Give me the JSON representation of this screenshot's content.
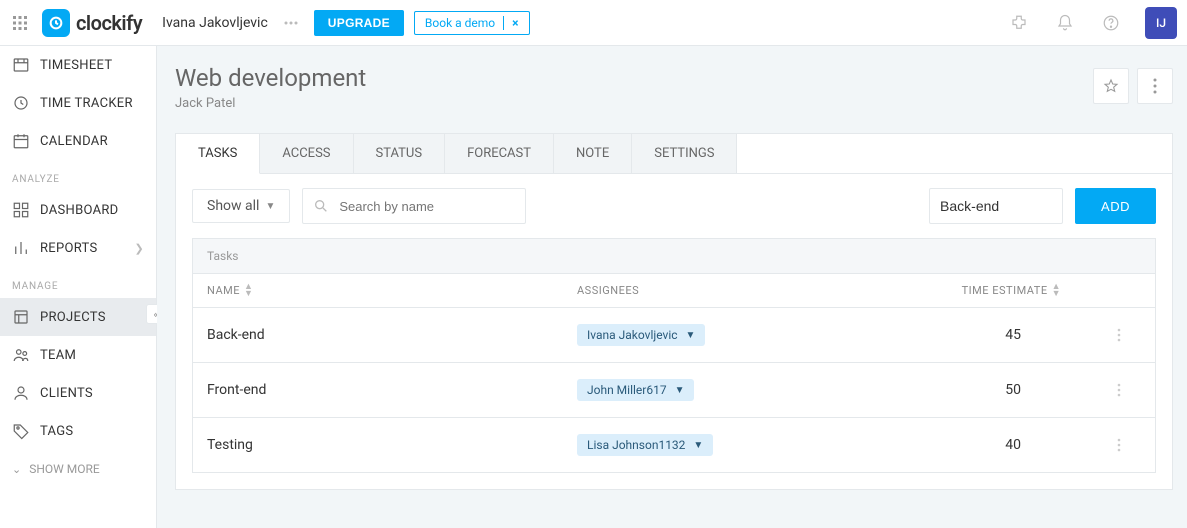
{
  "top": {
    "brand": "clockify",
    "user_display": "Ivana Jakovljevic",
    "upgrade": "UPGRADE",
    "book_demo": "Book a demo",
    "avatar_initials": "IJ"
  },
  "sidebar": {
    "items_primary": [
      {
        "label": "TIMESHEET"
      },
      {
        "label": "TIME TRACKER"
      },
      {
        "label": "CALENDAR"
      }
    ],
    "section_analyze": "ANALYZE",
    "items_analyze": [
      {
        "label": "DASHBOARD"
      },
      {
        "label": "REPORTS",
        "chevron": true
      }
    ],
    "section_manage": "MANAGE",
    "items_manage": [
      {
        "label": "PROJECTS",
        "active": true
      },
      {
        "label": "TEAM"
      },
      {
        "label": "CLIENTS"
      },
      {
        "label": "TAGS"
      }
    ],
    "show_more": "SHOW MORE"
  },
  "page": {
    "title": "Web development",
    "subtitle": "Jack Patel"
  },
  "tabs": [
    {
      "label": "TASKS",
      "active": true
    },
    {
      "label": "ACCESS"
    },
    {
      "label": "STATUS"
    },
    {
      "label": "FORECAST"
    },
    {
      "label": "NOTE"
    },
    {
      "label": "SETTINGS"
    }
  ],
  "toolbar": {
    "filter_label": "Show all",
    "search_placeholder": "Search by name",
    "new_task_value": "Back-end",
    "add_label": "ADD"
  },
  "grid": {
    "section_label": "Tasks",
    "col_name": "NAME",
    "col_assign": "ASSIGNEES",
    "col_est": "TIME ESTIMATE",
    "rows": [
      {
        "name": "Back-end",
        "assignee": "Ivana Jakovljevic",
        "estimate": "45"
      },
      {
        "name": "Front-end",
        "assignee": "John Miller617",
        "estimate": "50"
      },
      {
        "name": "Testing",
        "assignee": "Lisa Johnson1132",
        "estimate": "40"
      }
    ]
  }
}
